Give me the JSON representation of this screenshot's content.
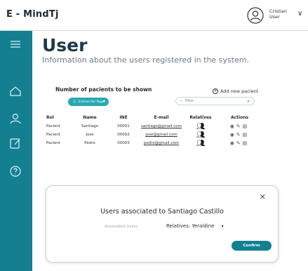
{
  "header": {
    "app_title": "E - MindTj",
    "user_name_line1": "Cristian",
    "user_name_line2": "User",
    "chevron": "∨"
  },
  "page": {
    "title": "User",
    "subtitle": "Information about the users registered in the system."
  },
  "controls": {
    "count_label": "Number of pacients to be shown",
    "per_page_label": "Entries Per Page",
    "per_page_icon": "☰",
    "per_page_chevron": "▾",
    "add_new_label": "Add new pacient",
    "filter_placeholder": "Filter",
    "filter_icon": "⌕"
  },
  "table": {
    "headers": {
      "rol": "Rol",
      "name": "Name",
      "ine": "INE",
      "email": "E-mail",
      "relatives": "Relatives",
      "actions": "Actions"
    },
    "rows": [
      {
        "rol": "Pacient",
        "name": "Santiago",
        "ine": "00001",
        "email": "santiago@gmail.com"
      },
      {
        "rol": "Pacient",
        "name": "Jose",
        "ine": "00002",
        "email": "jose@gmail.com"
      },
      {
        "rol": "Pacient",
        "name": "Pedro",
        "ine": "00003",
        "email": "pedro@gmail.com"
      }
    ],
    "icons": {
      "relatives": "people-icon",
      "view": "eye-icon",
      "edit": "pencil-icon",
      "delete": "trash-icon"
    }
  },
  "modal": {
    "close": "✕",
    "title": "Users associated to Santiago Castillo",
    "label": "Associated Users",
    "selected": "Relatives: Yeraldine",
    "chevron": "▾",
    "confirm_label": "Confirm"
  },
  "colors": {
    "sidebar": "#137f91",
    "accent": "#2aa7b2"
  }
}
